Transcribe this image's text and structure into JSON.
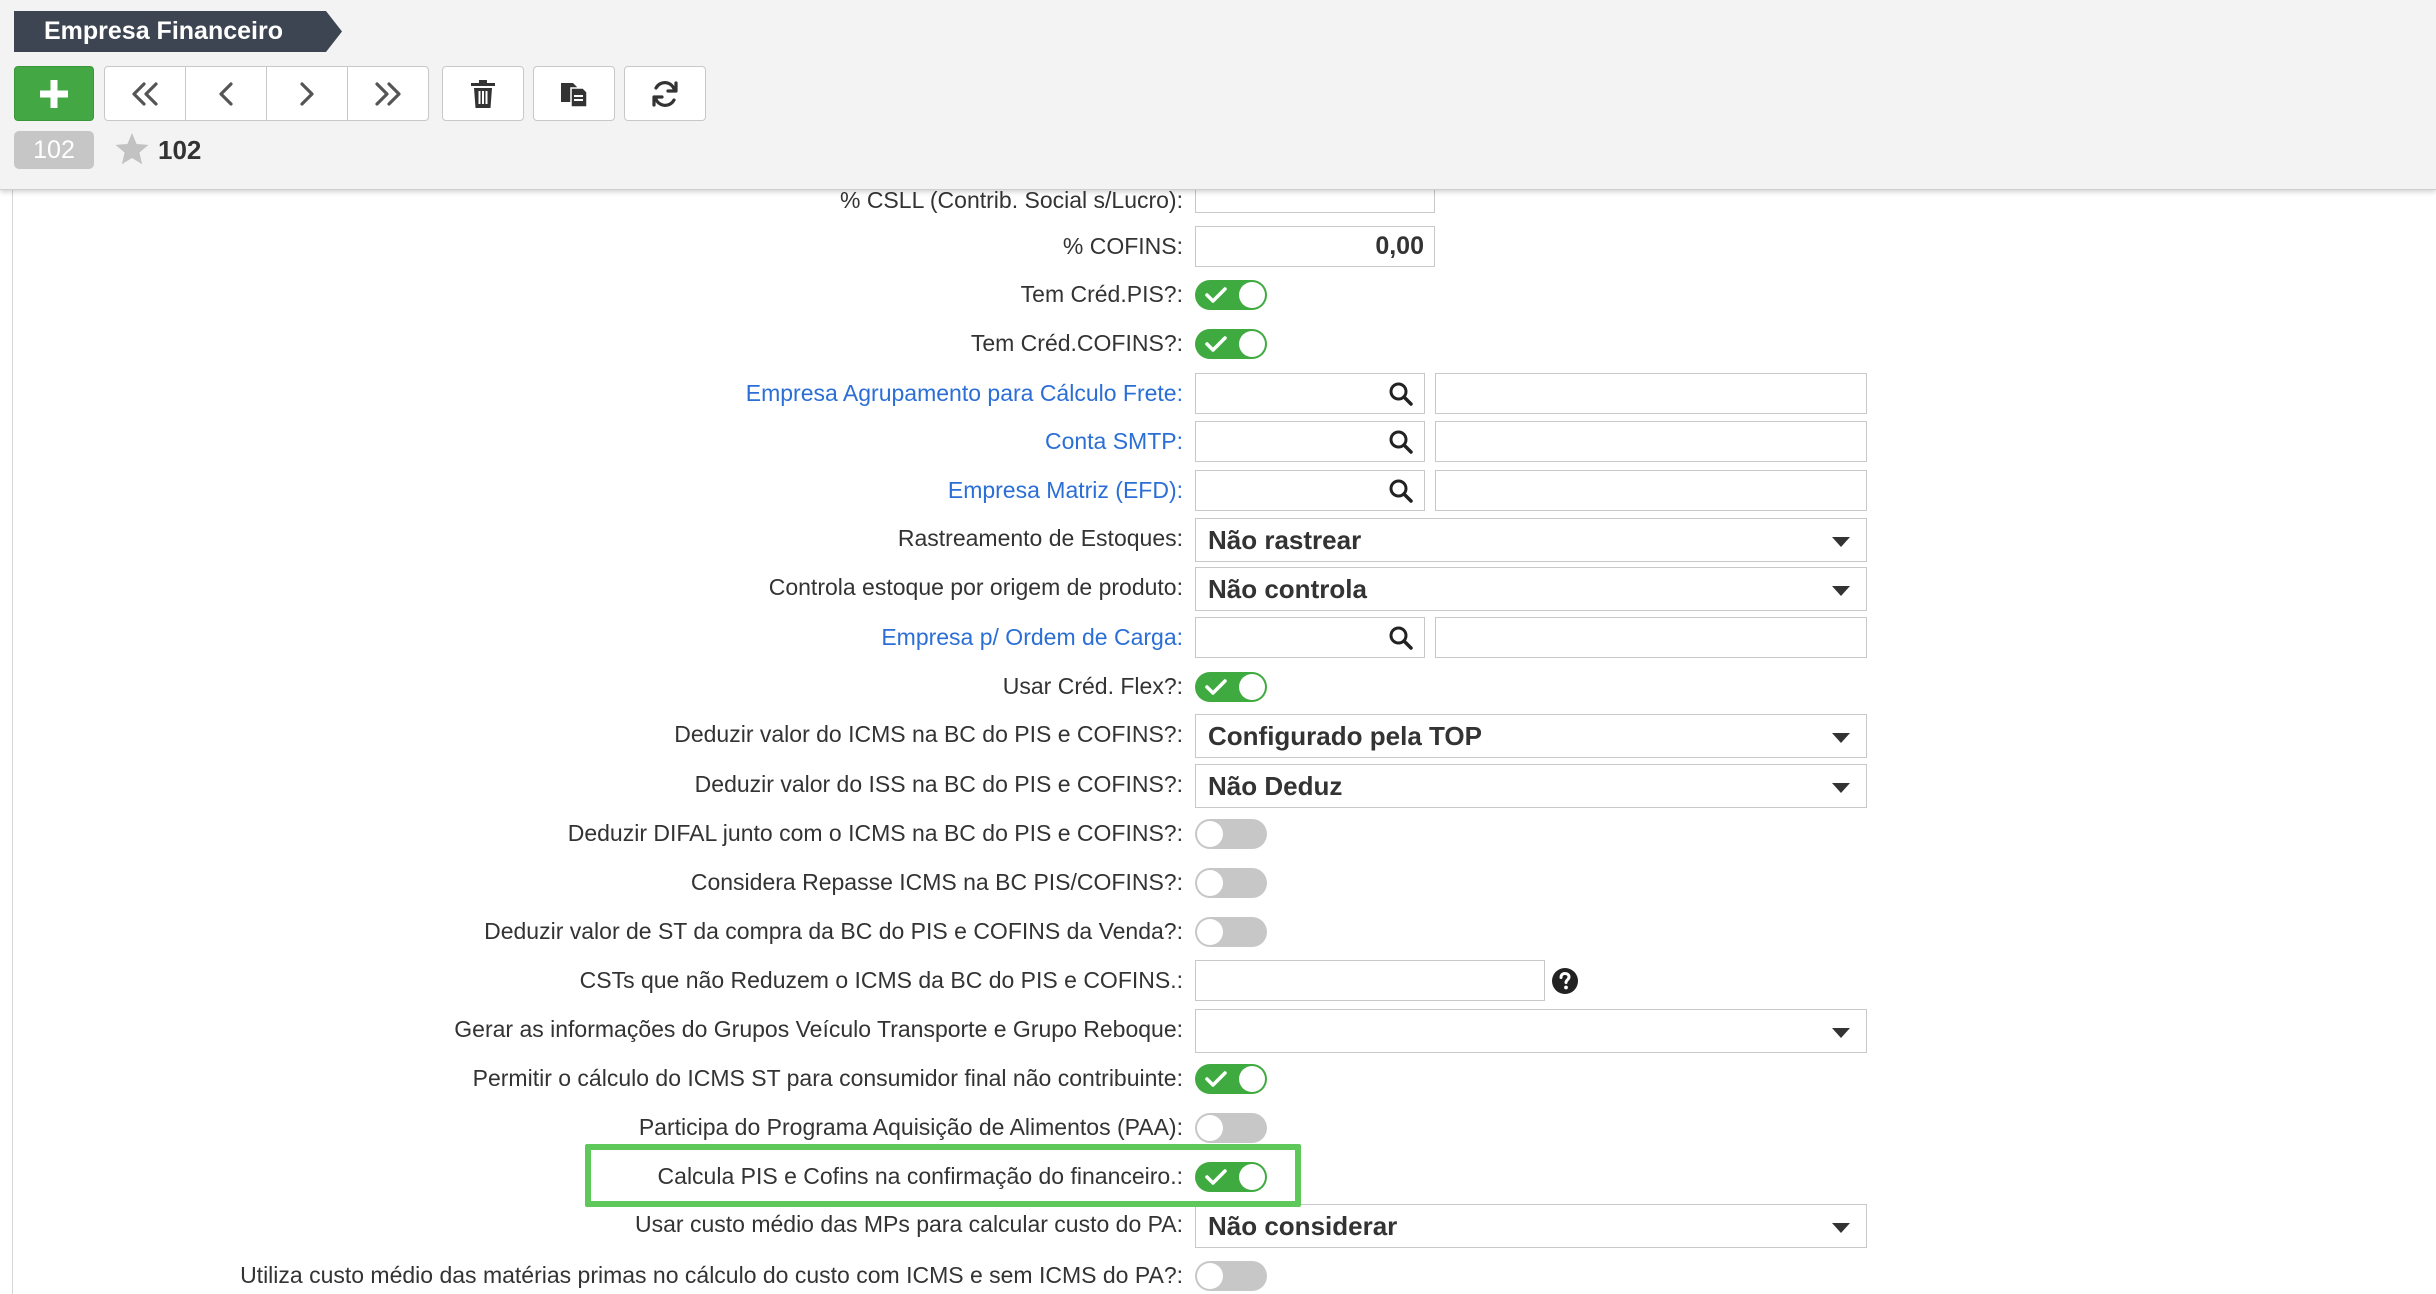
{
  "header": {
    "title": "Empresa Financeiro",
    "record_count": "102",
    "favorite_count": "102"
  },
  "toolbar": {
    "buttons": [
      "add-icon",
      "first-record-icon",
      "previous-record-icon",
      "next-record-icon",
      "last-record-icon",
      "trash-icon",
      "copy-icon",
      "refresh-icon"
    ]
  },
  "colors": {
    "accent_green": "#43a843",
    "toggle_on": "#3faa3f",
    "toggle_off": "#c7c7c7",
    "link_blue": "#2b6fd6",
    "highlight_border": "#5ec85b",
    "title_bg": "#3d4552"
  },
  "form": {
    "csll_label": "% CSLL (Contrib. Social s/Lucro):",
    "cofins_label": "% COFINS:",
    "cofins_value": "0,00",
    "cred_pis_label": "Tem Créd.PIS?:",
    "cred_cofins_label": "Tem Créd.COFINS?:",
    "empresa_agrup_label": "Empresa Agrupamento para Cálculo Frete:",
    "conta_smtp_label": "Conta SMTP:",
    "empresa_matriz_label": "Empresa Matriz (EFD):",
    "rastreamento_label": "Rastreamento de Estoques:",
    "rastreamento_value": "Não rastrear",
    "controla_estoque_label": "Controla estoque por origem de produto:",
    "controla_estoque_value": "Não controla",
    "empresa_ordem_label": "Empresa p/ Ordem de Carga:",
    "cred_flex_label": "Usar Créd. Flex?:",
    "deduzir_icms_label": "Deduzir valor do ICMS na BC do PIS e COFINS?:",
    "deduzir_icms_value": "Configurado pela TOP",
    "deduzir_iss_label": "Deduzir valor do ISS na BC do PIS e COFINS?:",
    "deduzir_iss_value": "Não Deduz",
    "deduzir_difal_label": "Deduzir DIFAL junto com o ICMS na BC do PIS e COFINS?:",
    "repasse_icms_label": "Considera Repasse ICMS na BC PIS/COFINS?:",
    "deduzir_st_label": "Deduzir valor de ST da compra da BC do PIS e COFINS da Venda?:",
    "csts_label": "CSTs que não Reduzem o ICMS da BC do PIS e COFINS.:",
    "gerar_info_label": "Gerar as informações do Grupos Veículo Transporte e Grupo Reboque:",
    "gerar_info_value": "",
    "icms_st_label": "Permitir o cálculo do ICMS ST para consumidor final não contribuinte:",
    "paa_label": "Participa do Programa Aquisição de Alimentos (PAA):",
    "calcula_pis_label": "Calcula PIS e Cofins na confirmação do financeiro.:",
    "custo_medio_label": "Usar custo médio das MPs para calcular custo do PA:",
    "custo_medio_value": "Não considerar",
    "utiliza_custo_label": "Utiliza custo médio das matérias primas no cálculo do custo com ICMS e sem ICMS do PA?:"
  }
}
